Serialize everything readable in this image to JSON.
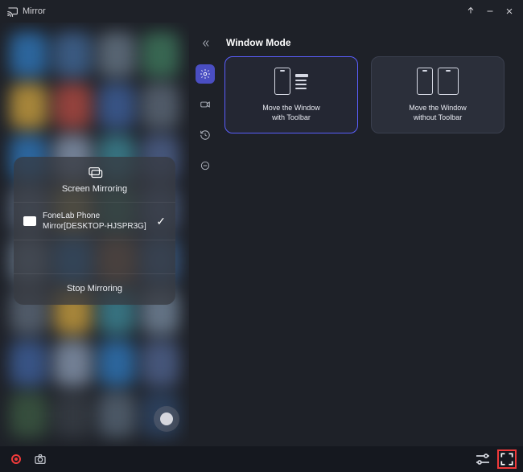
{
  "app": {
    "title": "Mirror"
  },
  "section": {
    "title": "Window Mode"
  },
  "cards": {
    "with_toolbar": "Move the Window\nwith Toolbar",
    "without_toolbar": "Move the Window\nwithout Toolbar"
  },
  "mirroring": {
    "title": "Screen Mirroring",
    "device_line1": "FoneLab Phone",
    "device_line2": "Mirror[DESKTOP-HJSPR3G]",
    "stop": "Stop Mirroring"
  },
  "colors": {
    "accent": "#5a5efc",
    "danger": "#f03a3a",
    "bg": "#1e2128"
  }
}
